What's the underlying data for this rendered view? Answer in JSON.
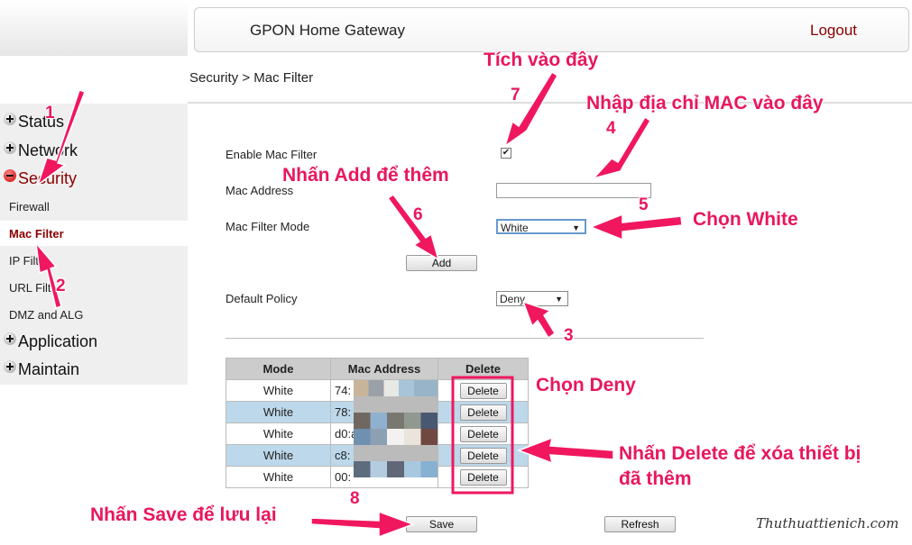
{
  "header": {
    "title": "GPON Home Gateway",
    "logout": "Logout"
  },
  "breadcrumb": "Security > Mac Filter",
  "sidebar": {
    "menus": [
      {
        "label": "Status",
        "icon": "plus-icon"
      },
      {
        "label": "Network",
        "icon": "plus-icon"
      },
      {
        "label": "Security",
        "icon": "minus-icon"
      },
      {
        "label": "Application",
        "icon": "plus-icon"
      },
      {
        "label": "Maintain",
        "icon": "plus-icon"
      }
    ],
    "security_items": [
      "Firewall",
      "Mac Filter",
      "IP Filter",
      "URL Filter",
      "DMZ and ALG"
    ],
    "active": "Mac Filter"
  },
  "form": {
    "enable_label": "Enable Mac Filter",
    "enable_checked": true,
    "mac_label": "Mac Address",
    "mac_value": "",
    "mode_label": "Mac Filter Mode",
    "mode_value": "White",
    "add": "Add",
    "policy_label": "Default Policy",
    "policy_value": "Deny"
  },
  "table": {
    "headers": [
      "Mode",
      "Mac Address",
      "Delete"
    ],
    "rows": [
      {
        "mode": "White",
        "mac": "74:"
      },
      {
        "mode": "White",
        "mac": "78:"
      },
      {
        "mode": "White",
        "mac": "d0:a"
      },
      {
        "mode": "White",
        "mac": "c8:"
      },
      {
        "mode": "White",
        "mac": "00:"
      }
    ],
    "delete": "Delete"
  },
  "buttons": {
    "save": "Save",
    "refresh": "Refresh"
  },
  "annotations": {
    "a7": "Tích vào đây",
    "n7": "7",
    "a4": "Nhập địa chỉ MAC vào đây",
    "n4": "4",
    "a6": "Nhấn Add để thêm",
    "n6": "6",
    "n5": "5",
    "a5": "Chọn White",
    "n3": "3",
    "a3": "Chọn Deny",
    "a_del": "Nhấn Delete để xóa thiết bị",
    "a_del2": "đã thêm",
    "n8": "8",
    "a8": "Nhấn Save để lưu lại",
    "n1": "1",
    "n2": "2",
    "watermark": "Thuthuattienich.com"
  },
  "colors": {
    "accent": "#8b0000",
    "annotation": "#e8175d",
    "row_alt": "#bcd8ea"
  }
}
